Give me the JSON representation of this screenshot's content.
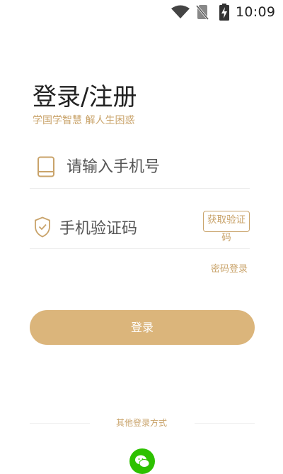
{
  "status_bar": {
    "time": "10:09",
    "icons": [
      "wifi-icon",
      "no-sim-icon",
      "battery-charging-icon"
    ]
  },
  "page": {
    "title": "登录/注册",
    "slogan": "学国学智慧 解人生困惑"
  },
  "form": {
    "phone_placeholder": "请输入手机号",
    "phone_icon": "phone-icon",
    "code_placeholder": "手机验证码",
    "code_icon": "shield-check-icon",
    "get_code_label": "获取验证码",
    "password_login_label": "密码登录",
    "login_label": "登录"
  },
  "other_login": {
    "label": "其他登录方式",
    "wechat_icon": "wechat-icon"
  },
  "colors": {
    "accent": "#c9a36a",
    "button": "#dbb57b",
    "wechat": "#2dc100"
  }
}
